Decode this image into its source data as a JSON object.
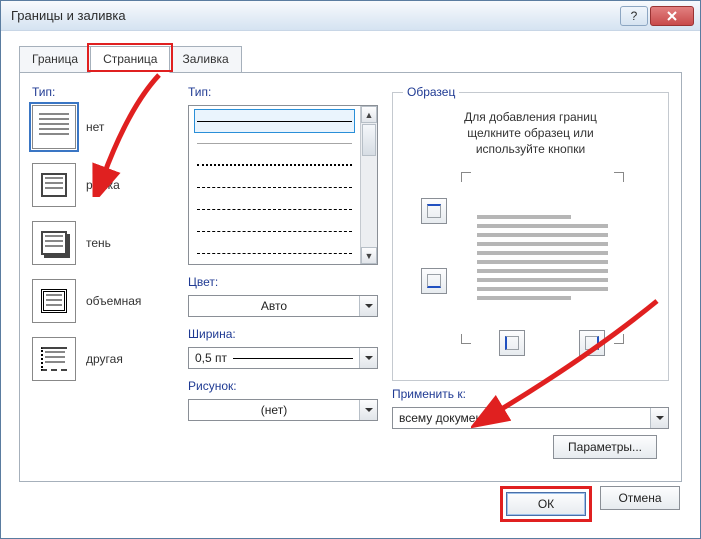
{
  "window": {
    "title": "Границы и заливка"
  },
  "tabs": {
    "border": "Граница",
    "page": "Страница",
    "shading": "Заливка"
  },
  "labels": {
    "setting": "Тип:",
    "style": "Тип:",
    "color": "Цвет:",
    "width": "Ширина:",
    "art": "Рисунок:",
    "preview": "Образец",
    "preview_hint_l1": "Для добавления границ",
    "preview_hint_l2": "щелкните образец или",
    "preview_hint_l3": "используйте кнопки",
    "apply_to": "Применить к:",
    "options": "Параметры...",
    "ok": "ОК",
    "cancel": "Отмена"
  },
  "settings": {
    "none": "нет",
    "box": "рамка",
    "shadow": "тень",
    "threeD": "объемная",
    "custom": "другая"
  },
  "values": {
    "color": "Авто",
    "width": "0,5 пт",
    "art": "(нет)",
    "apply_to": "всему документу"
  }
}
